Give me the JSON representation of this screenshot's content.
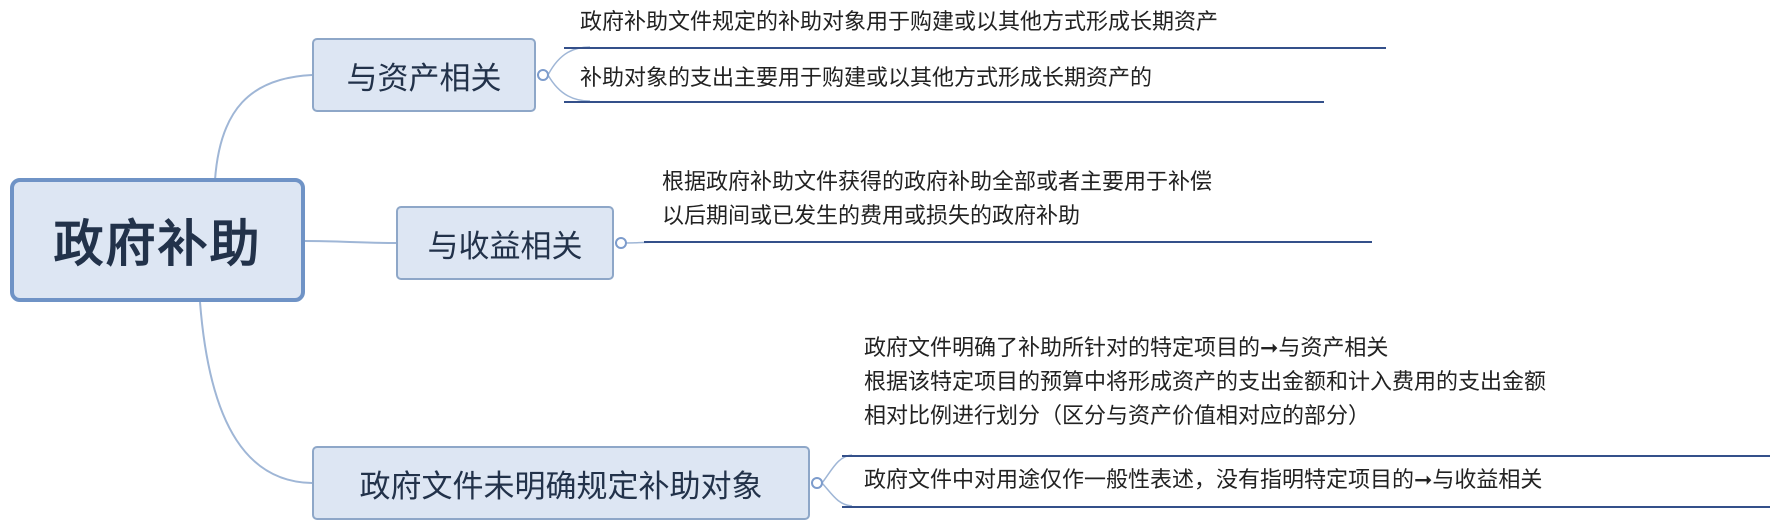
{
  "root": {
    "label": "政府补助"
  },
  "branches": [
    {
      "label": "与资产相关",
      "leaves": [
        "政府补助文件规定的补助对象用于购建或以其他方式形成长期资产",
        "补助对象的支出主要用于购建或以其他方式形成长期资产的"
      ]
    },
    {
      "label": "与收益相关",
      "leaves": [
        "根据政府补助文件获得的政府补助全部或者主要用于补偿\n以后期间或已发生的费用或损失的政府补助"
      ]
    },
    {
      "label": "政府文件未明确规定补助对象",
      "leaves": [
        "政府文件明确了补助所针对的特定项目的➞与资产相关\n根据该特定项目的预算中将形成资产的支出金额和计入费用的支出金额\n相对比例进行划分（区分与资产价值相对应的部分）",
        "政府文件中对用途仅作一般性表述，没有指明特定项目的➞与收益相关"
      ]
    }
  ]
}
